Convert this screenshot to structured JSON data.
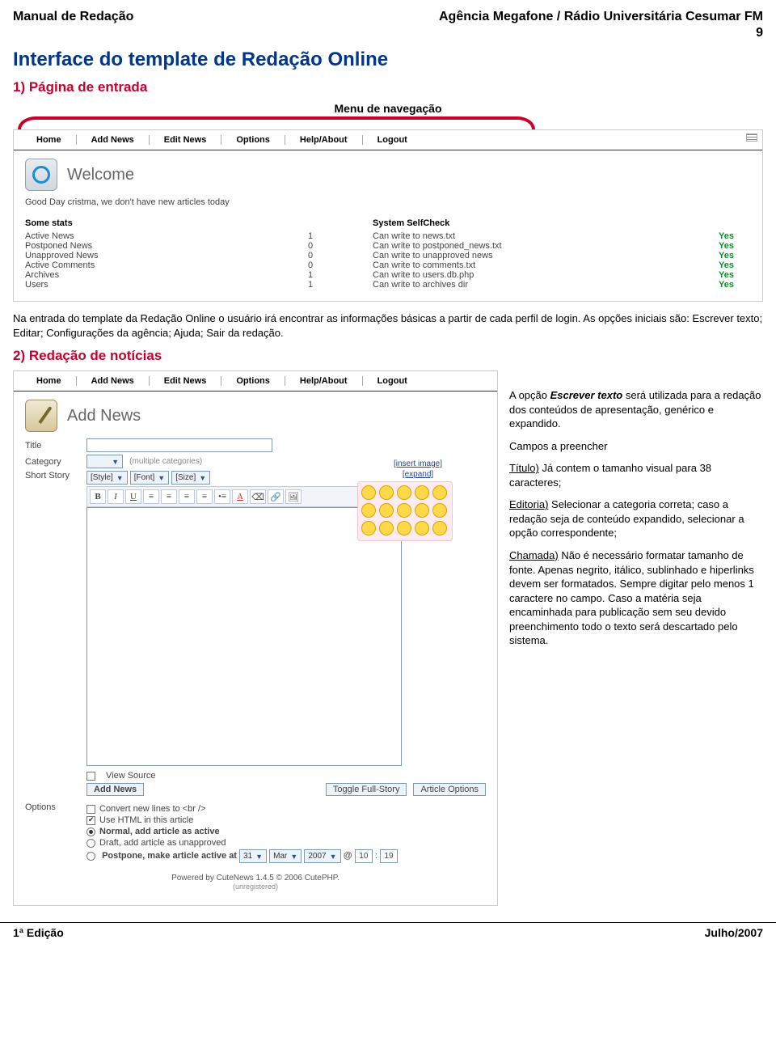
{
  "header": {
    "left": "Manual de Redação",
    "right": "Agência Megafone / Rádio Universitária Cesumar FM",
    "page_number": "9"
  },
  "title_main": "Interface do template de Redação Online",
  "section1": {
    "heading": "1) Página de entrada",
    "caption": "Menu de navegação"
  },
  "nav": {
    "items": [
      "Home",
      "Add News",
      "Edit News",
      "Options",
      "Help/About",
      "Logout"
    ]
  },
  "welcome_screen": {
    "title": "Welcome",
    "greeting": "Good Day cristma, we don't have new articles today",
    "stats_heading": "Some stats",
    "stats": [
      {
        "k": "Active News",
        "v": "1"
      },
      {
        "k": "Postponed News",
        "v": "0"
      },
      {
        "k": "Unapproved News",
        "v": "0"
      },
      {
        "k": "Active Comments",
        "v": "0"
      },
      {
        "k": "Archives",
        "v": "1"
      },
      {
        "k": "Users",
        "v": "1"
      }
    ],
    "selfcheck_heading": "System SelfCheck",
    "selfcheck": [
      {
        "k": "Can write to news.txt",
        "v": "Yes"
      },
      {
        "k": "Can write to postponed_news.txt",
        "v": "Yes"
      },
      {
        "k": "Can write to unapproved news",
        "v": "Yes"
      },
      {
        "k": "Can write to comments.txt",
        "v": "Yes"
      },
      {
        "k": "Can write to users.db.php",
        "v": "Yes"
      },
      {
        "k": "Can write to archives dir",
        "v": "Yes"
      }
    ]
  },
  "para1": "Na entrada do template da Redação Online o usuário irá encontrar as informações básicas a partir de cada perfil de login. As opções iniciais são: Escrever texto; Editar; Configurações da agência; Ajuda; Sair da redação.",
  "section2": {
    "heading": "2) Redação de notícias"
  },
  "addnews_screen": {
    "title": "Add News",
    "labels": {
      "title": "Title",
      "category": "Category",
      "short": "Short Story",
      "options": "Options"
    },
    "category_hint": "(multiple categories)",
    "style_dd": "[Style]",
    "font_dd": "[Font]",
    "size_dd": "[Size]",
    "side_links": [
      "[insert image]",
      "[expand]"
    ],
    "view_source": "View Source",
    "buttons": {
      "add": "Add News",
      "toggle": "Toggle Full-Story",
      "options": "Article Options"
    },
    "options": {
      "o1": "Convert new lines to <br />",
      "o2": "Use HTML in this article",
      "o3": "Normal, add article as active",
      "o4": "Draft, add article as unapproved",
      "o5_a": "Postpone, make article active at",
      "day": "31",
      "month": "Mar",
      "year": "2007",
      "at": "@",
      "hour": "10",
      "sep": ":",
      "min": "19"
    }
  },
  "footer_credit": {
    "line1": "Powered by CuteNews 1.4.5 © 2006 CutePHP.",
    "line2": "(unregistered)"
  },
  "side_text": {
    "p1a": "A opção ",
    "p1b": "Escrever texto",
    "p1c": " será utilizada para a redação dos conteúdos de apresentação, genérico e expandido.",
    "p2": "Campos a preencher",
    "p3a": "Título)",
    "p3b": " Já contem o tamanho visual para 38 caracteres;",
    "p4a": "Editoria)",
    "p4b": " Selecionar a categoria correta; caso a redação seja de conteúdo expandido, selecionar a opção correspondente;",
    "p5a": "Chamada)",
    "p5b": " Não é necessário formatar tamanho de fonte. Apenas negrito, itálico, sublinhado e hiperlinks devem ser formatados. Sempre digitar pelo menos 1 caractere no campo. Caso a matéria seja encaminhada para publicação sem seu devido preenchimento todo o texto será descartado pelo sistema."
  },
  "page_footer": {
    "left": "1ª Edição",
    "right": "Julho/2007"
  }
}
